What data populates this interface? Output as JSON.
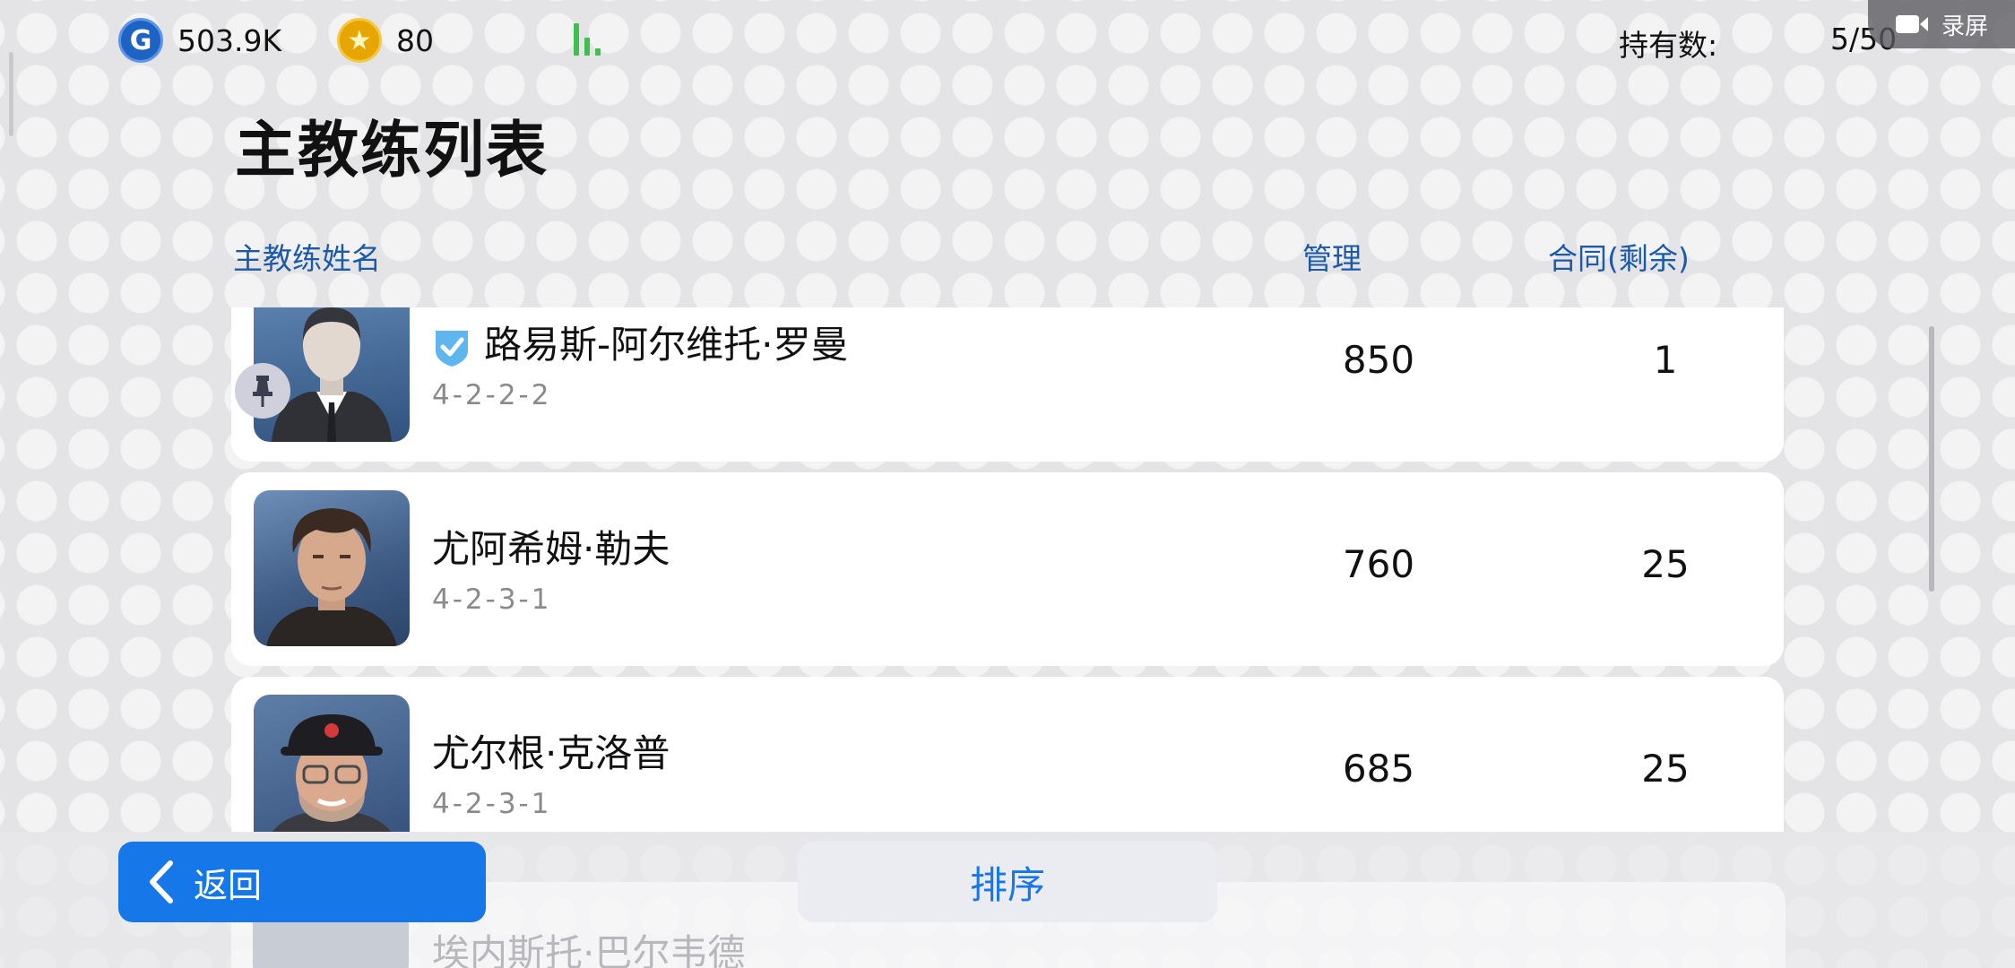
{
  "top_bar": {
    "gp_value": "503.9K",
    "coins_value": "80",
    "holdings_label": "持有数:",
    "holdings_value": "5/50",
    "record_label": "录屏"
  },
  "page": {
    "title": "主教练列表"
  },
  "columns": {
    "name": "主教练姓名",
    "management": "管理",
    "contract": "合同(剩余)"
  },
  "coaches": [
    {
      "name": "路易斯-阿尔维托·罗曼",
      "formation": "4-2-2-2",
      "management": "850",
      "contract": "1",
      "verified": true,
      "pinned": true
    },
    {
      "name": "尤阿希姆·勒夫",
      "formation": "4-2-3-1",
      "management": "760",
      "contract": "25"
    },
    {
      "name": "尤尔根·克洛普",
      "formation": "4-2-3-1",
      "management": "685",
      "contract": "25"
    },
    {
      "name": "埃内斯托·巴尔韦德"
    }
  ],
  "buttons": {
    "back": "返回",
    "sort": "排序"
  },
  "colors": {
    "accent_blue": "#1677e8",
    "header_blue": "#1c5aa8",
    "signal_green": "#3fbf4f"
  },
  "icons": [
    "gp-coin-icon",
    "star-coin-icon",
    "signal-icon",
    "video-camera-icon",
    "verified-shield-icon",
    "pin-icon",
    "chevron-left-icon"
  ]
}
